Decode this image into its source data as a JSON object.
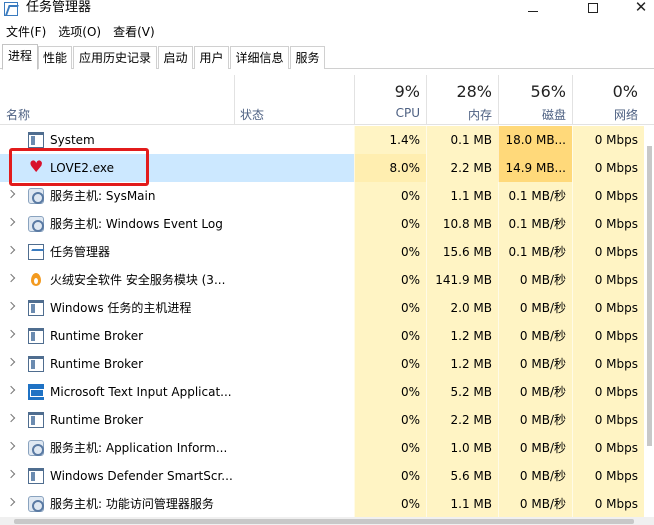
{
  "window": {
    "title": "任务管理器"
  },
  "menu": {
    "items": [
      "文件(F)",
      "选项(O)",
      "查看(V)"
    ]
  },
  "tabs": [
    "进程",
    "性能",
    "应用历史记录",
    "启动",
    "用户",
    "详细信息",
    "服务"
  ],
  "header": {
    "name": "名称",
    "status": "状态",
    "cpu": {
      "pct": "9%",
      "label": "CPU"
    },
    "memory": {
      "pct": "28%",
      "label": "内存"
    },
    "disk": {
      "pct": "56%",
      "label": "磁盘"
    },
    "network": {
      "pct": "0%",
      "label": "网络"
    }
  },
  "processes": [
    {
      "name": "System",
      "cpu": "1.4%",
      "mem": "0.1 MB",
      "disk": "18.0 MB...",
      "net": "0 Mbps",
      "icon": "window-icon"
    },
    {
      "name": "LOVE2.exe",
      "cpu": "8.0%",
      "mem": "2.2 MB",
      "disk": "14.9 MB...",
      "net": "0 Mbps",
      "icon": "heart-icon"
    },
    {
      "name": "服务主机: SysMain",
      "cpu": "0%",
      "mem": "1.1 MB",
      "disk": "0.1 MB/秒",
      "net": "0 Mbps",
      "icon": "gear-icon"
    },
    {
      "name": "服务主机: Windows Event Log",
      "cpu": "0%",
      "mem": "10.8 MB",
      "disk": "0.1 MB/秒",
      "net": "0 Mbps",
      "icon": "gear-icon"
    },
    {
      "name": "任务管理器",
      "cpu": "0%",
      "mem": "15.6 MB",
      "disk": "0.1 MB/秒",
      "net": "0 Mbps",
      "icon": "task-manager-icon"
    },
    {
      "name": "火绒安全软件 安全服务模块 (3...",
      "cpu": "0%",
      "mem": "141.9 MB",
      "disk": "0 MB/秒",
      "net": "0 Mbps",
      "icon": "flame-icon"
    },
    {
      "name": "Windows 任务的主机进程",
      "cpu": "0%",
      "mem": "2.0 MB",
      "disk": "0 MB/秒",
      "net": "0 Mbps",
      "icon": "window-icon"
    },
    {
      "name": "Runtime Broker",
      "cpu": "0%",
      "mem": "1.2 MB",
      "disk": "0 MB/秒",
      "net": "0 Mbps",
      "icon": "window-icon"
    },
    {
      "name": "Runtime Broker",
      "cpu": "0%",
      "mem": "1.2 MB",
      "disk": "0 MB/秒",
      "net": "0 Mbps",
      "icon": "window-icon"
    },
    {
      "name": "Microsoft Text Input Applicat...",
      "cpu": "0%",
      "mem": "5.2 MB",
      "disk": "0 MB/秒",
      "net": "0 Mbps",
      "icon": "keyboard-icon"
    },
    {
      "name": "Runtime Broker",
      "cpu": "0%",
      "mem": "2.2 MB",
      "disk": "0 MB/秒",
      "net": "0 Mbps",
      "icon": "window-icon"
    },
    {
      "name": "服务主机: Application Inform...",
      "cpu": "0%",
      "mem": "1.0 MB",
      "disk": "0 MB/秒",
      "net": "0 Mbps",
      "icon": "gear-icon"
    },
    {
      "name": "Windows Defender SmartScr...",
      "cpu": "0%",
      "mem": "5.6 MB",
      "disk": "0 MB/秒",
      "net": "0 Mbps",
      "icon": "window-icon"
    },
    {
      "name": "服务主机: 功能访问管理器服务",
      "cpu": "0%",
      "mem": "1.1 MB",
      "disk": "0 MB/秒",
      "net": "0 Mbps",
      "icon": "gear-icon"
    }
  ],
  "colors": {
    "highlight": "#e21b1b",
    "selected": "#cce8ff",
    "heat_light": "#fff4c4",
    "heat_strong": "#ffd97a"
  }
}
